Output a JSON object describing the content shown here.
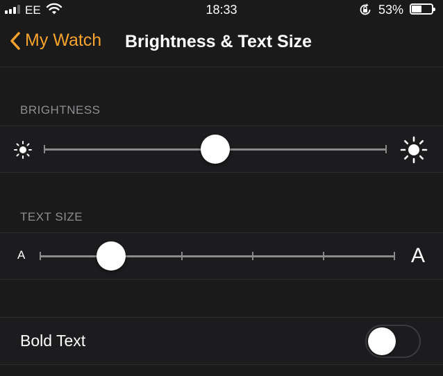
{
  "status_bar": {
    "carrier": "EE",
    "time": "18:33",
    "battery_percent_label": "53%",
    "battery_level": 0.53,
    "signal_bars_filled": 3,
    "icons": [
      "signal-icon",
      "wifi-icon",
      "orientation-lock-icon",
      "battery-icon"
    ]
  },
  "nav": {
    "back_label": "My Watch",
    "title": "Brightness & Text Size",
    "accent_color": "#f7a22d"
  },
  "brightness": {
    "header": "BRIGHTNESS",
    "value": 0.5,
    "min_icon": "sun-small-icon",
    "max_icon": "sun-large-icon"
  },
  "text_size": {
    "header": "TEXT SIZE",
    "steps": 6,
    "selected_step": 2,
    "min_label": "A",
    "max_label": "A"
  },
  "bold_text": {
    "label": "Bold Text",
    "enabled": false
  }
}
